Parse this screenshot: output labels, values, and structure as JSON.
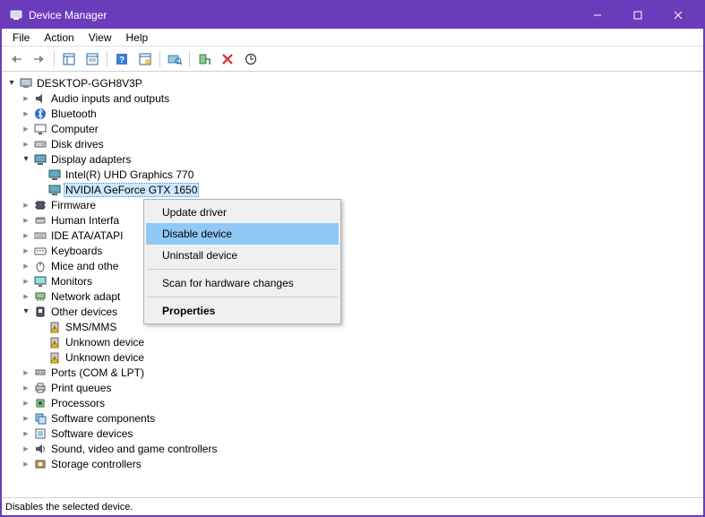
{
  "window": {
    "title": "Device Manager"
  },
  "menubar": {
    "file": "File",
    "action": "Action",
    "view": "View",
    "help": "Help"
  },
  "tree": {
    "root": "DESKTOP-GGH8V3P",
    "audio": "Audio inputs and outputs",
    "bluetooth": "Bluetooth",
    "computer": "Computer",
    "disk": "Disk drives",
    "display": "Display adapters",
    "display_intel": "Intel(R) UHD Graphics 770",
    "display_nvidia": "NVIDIA GeForce GTX 1650",
    "firmware": "Firmware",
    "hid": "Human Interfa",
    "ide": "IDE ATA/ATAPI",
    "keyboards": "Keyboards",
    "mice": "Mice and othe",
    "monitors": "Monitors",
    "network": "Network adapt",
    "other": "Other devices",
    "other_sms": "SMS/MMS",
    "other_unknown1": "Unknown device",
    "other_unknown2": "Unknown device",
    "ports": "Ports (COM & LPT)",
    "printq": "Print queues",
    "processors": "Processors",
    "swcomp": "Software components",
    "swdev": "Software devices",
    "sound": "Sound, video and game controllers",
    "storage": "Storage controllers"
  },
  "context_menu": {
    "update": "Update driver",
    "disable": "Disable device",
    "uninstall": "Uninstall device",
    "scan": "Scan for hardware changes",
    "properties": "Properties"
  },
  "statusbar": {
    "text": "Disables the selected device."
  }
}
